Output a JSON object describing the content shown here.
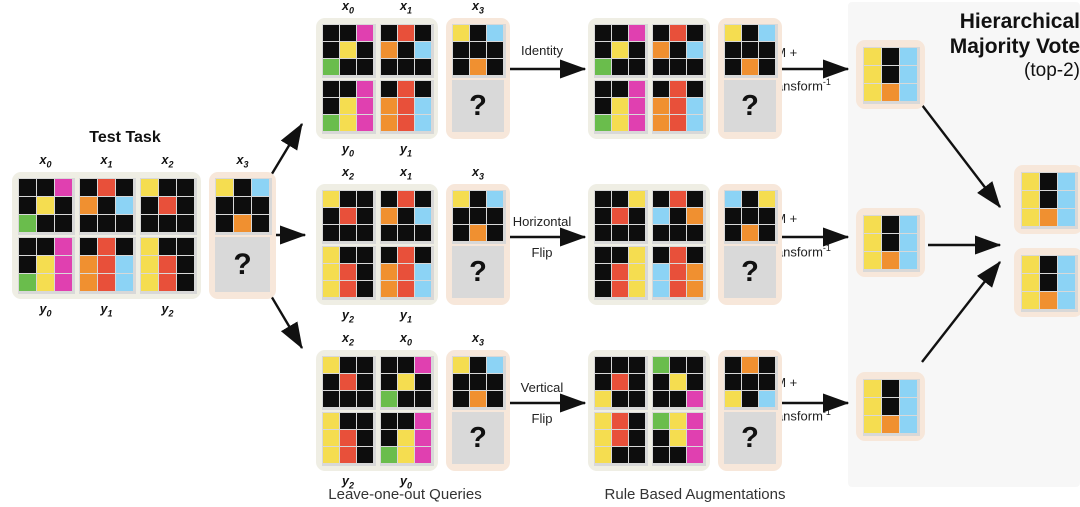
{
  "palette": {
    "black": "#0d0d0d",
    "yellow": "#f5dd50",
    "magenta": "#e040b0",
    "green": "#6abd4c",
    "red": "#e8503a",
    "orange": "#f09030",
    "blue": "#8cd3f5",
    "card_ivory": "#efeee4",
    "card_peach": "#f7e7da",
    "question_bg": "#d9d9d9",
    "panel_bg": "#f7f7f7",
    "grid_line": "#d8d8d8",
    "ink": "#111111"
  },
  "headings": {
    "test_task": "Test Task",
    "hierarchical_majority_vote_l1": "Hierarchical",
    "hierarchical_majority_vote_l2": "Majority Vote",
    "hierarchical_majority_vote_l3": "(top-2)"
  },
  "footer": {
    "leave_one_out": "Leave-one-out Queries",
    "rule_based": "Rule Based Augmentations"
  },
  "transform_labels": {
    "identity": "Identity",
    "horizontal_flip_l1": "Horizontal",
    "horizontal_flip_l2": "Flip",
    "vertical_flip_l1": "Vertical",
    "vertical_flip_l2": "Flip"
  },
  "lm_label": {
    "line1": "LM +",
    "line2": "transform",
    "sup": "-1"
  },
  "question_mark": "?",
  "grid_labels": {
    "x0": "x",
    "x1": "x",
    "x2": "x",
    "x3": "x",
    "y0": "y",
    "y1": "y",
    "y2": "y",
    "sub0": "0",
    "sub1": "1",
    "sub2": "2",
    "sub3": "3"
  },
  "test_task": {
    "pairs": [
      {
        "x_label": "x",
        "x_sub": "0",
        "y_label": "y",
        "y_sub": "0",
        "input": [
          [
            "black",
            "black",
            "magenta"
          ],
          [
            "black",
            "yellow",
            "black"
          ],
          [
            "green",
            "black",
            "black"
          ]
        ],
        "output": [
          [
            "black",
            "black",
            "magenta"
          ],
          [
            "black",
            "yellow",
            "magenta"
          ],
          [
            "green",
            "yellow",
            "magenta"
          ]
        ]
      },
      {
        "x_label": "x",
        "x_sub": "1",
        "y_label": "y",
        "y_sub": "1",
        "input": [
          [
            "black",
            "red",
            "black"
          ],
          [
            "orange",
            "black",
            "blue"
          ],
          [
            "black",
            "black",
            "black"
          ]
        ],
        "output": [
          [
            "black",
            "red",
            "black"
          ],
          [
            "orange",
            "red",
            "blue"
          ],
          [
            "orange",
            "red",
            "blue"
          ]
        ]
      },
      {
        "x_label": "x",
        "x_sub": "2",
        "y_label": "y",
        "y_sub": "2",
        "input": [
          [
            "yellow",
            "black",
            "black"
          ],
          [
            "black",
            "red",
            "black"
          ],
          [
            "black",
            "black",
            "black"
          ]
        ],
        "output": [
          [
            "yellow",
            "black",
            "black"
          ],
          [
            "yellow",
            "red",
            "black"
          ],
          [
            "yellow",
            "red",
            "black"
          ]
        ]
      }
    ],
    "query": {
      "x_label": "x",
      "x_sub": "3",
      "input": [
        [
          "yellow",
          "black",
          "blue"
        ],
        [
          "black",
          "black",
          "black"
        ],
        [
          "black",
          "orange",
          "black"
        ]
      ],
      "answer": "?"
    }
  },
  "queries": [
    {
      "name": "leave-out-query-row-1",
      "pairs": [
        {
          "x_label": "x",
          "x_sub": "0",
          "y_label": "y",
          "y_sub": "0",
          "input": [
            [
              "black",
              "black",
              "magenta"
            ],
            [
              "black",
              "yellow",
              "black"
            ],
            [
              "green",
              "black",
              "black"
            ]
          ],
          "output": [
            [
              "black",
              "black",
              "magenta"
            ],
            [
              "black",
              "yellow",
              "magenta"
            ],
            [
              "green",
              "yellow",
              "magenta"
            ]
          ]
        },
        {
          "x_label": "x",
          "x_sub": "1",
          "y_label": "y",
          "y_sub": "1",
          "input": [
            [
              "black",
              "red",
              "black"
            ],
            [
              "orange",
              "black",
              "blue"
            ],
            [
              "black",
              "black",
              "black"
            ]
          ],
          "output": [
            [
              "black",
              "red",
              "black"
            ],
            [
              "orange",
              "red",
              "blue"
            ],
            [
              "orange",
              "red",
              "blue"
            ]
          ]
        }
      ],
      "query": {
        "x_label": "x",
        "x_sub": "3",
        "input": [
          [
            "yellow",
            "black",
            "blue"
          ],
          [
            "black",
            "black",
            "black"
          ],
          [
            "black",
            "orange",
            "black"
          ]
        ],
        "answer": "?"
      },
      "transform": "identity"
    },
    {
      "name": "leave-out-query-row-2",
      "pairs": [
        {
          "x_label": "x",
          "x_sub": "2",
          "y_label": "y",
          "y_sub": "2",
          "input": [
            [
              "yellow",
              "black",
              "black"
            ],
            [
              "black",
              "red",
              "black"
            ],
            [
              "black",
              "black",
              "black"
            ]
          ],
          "output": [
            [
              "yellow",
              "black",
              "black"
            ],
            [
              "yellow",
              "red",
              "black"
            ],
            [
              "yellow",
              "red",
              "black"
            ]
          ]
        },
        {
          "x_label": "x",
          "x_sub": "1",
          "y_label": "y",
          "y_sub": "1",
          "input": [
            [
              "black",
              "red",
              "black"
            ],
            [
              "orange",
              "black",
              "blue"
            ],
            [
              "black",
              "black",
              "black"
            ]
          ],
          "output": [
            [
              "black",
              "red",
              "black"
            ],
            [
              "orange",
              "red",
              "blue"
            ],
            [
              "orange",
              "red",
              "blue"
            ]
          ]
        }
      ],
      "query": {
        "x_label": "x",
        "x_sub": "3",
        "input": [
          [
            "yellow",
            "black",
            "blue"
          ],
          [
            "black",
            "black",
            "black"
          ],
          [
            "black",
            "orange",
            "black"
          ]
        ],
        "answer": "?"
      },
      "transform": "horizontal_flip"
    },
    {
      "name": "leave-out-query-row-3",
      "pairs": [
        {
          "x_label": "x",
          "x_sub": "2",
          "y_label": "y",
          "y_sub": "2",
          "input": [
            [
              "yellow",
              "black",
              "black"
            ],
            [
              "black",
              "red",
              "black"
            ],
            [
              "black",
              "black",
              "black"
            ]
          ],
          "output": [
            [
              "yellow",
              "black",
              "black"
            ],
            [
              "yellow",
              "red",
              "black"
            ],
            [
              "yellow",
              "red",
              "black"
            ]
          ]
        },
        {
          "x_label": "x",
          "x_sub": "0",
          "y_label": "y",
          "y_sub": "0",
          "input": [
            [
              "black",
              "black",
              "magenta"
            ],
            [
              "black",
              "yellow",
              "black"
            ],
            [
              "green",
              "black",
              "black"
            ]
          ],
          "output": [
            [
              "black",
              "black",
              "magenta"
            ],
            [
              "black",
              "yellow",
              "magenta"
            ],
            [
              "green",
              "yellow",
              "magenta"
            ]
          ]
        }
      ],
      "query": {
        "x_label": "x",
        "x_sub": "3",
        "input": [
          [
            "yellow",
            "black",
            "blue"
          ],
          [
            "black",
            "black",
            "black"
          ],
          [
            "black",
            "orange",
            "black"
          ]
        ],
        "answer": "?"
      },
      "transform": "vertical_flip"
    }
  ],
  "augmentations": [
    {
      "name": "augmented-row-1",
      "pairs": [
        {
          "input": [
            [
              "black",
              "black",
              "magenta"
            ],
            [
              "black",
              "yellow",
              "black"
            ],
            [
              "green",
              "black",
              "black"
            ]
          ],
          "output": [
            [
              "black",
              "black",
              "magenta"
            ],
            [
              "black",
              "yellow",
              "magenta"
            ],
            [
              "green",
              "yellow",
              "magenta"
            ]
          ]
        },
        {
          "input": [
            [
              "black",
              "red",
              "black"
            ],
            [
              "orange",
              "black",
              "blue"
            ],
            [
              "black",
              "black",
              "black"
            ]
          ],
          "output": [
            [
              "black",
              "red",
              "black"
            ],
            [
              "orange",
              "red",
              "blue"
            ],
            [
              "orange",
              "red",
              "blue"
            ]
          ]
        }
      ],
      "query": {
        "input": [
          [
            "yellow",
            "black",
            "blue"
          ],
          [
            "black",
            "black",
            "black"
          ],
          [
            "black",
            "orange",
            "black"
          ]
        ],
        "answer": "?"
      }
    },
    {
      "name": "augmented-row-2",
      "pairs": [
        {
          "input": [
            [
              "black",
              "black",
              "yellow"
            ],
            [
              "black",
              "red",
              "black"
            ],
            [
              "black",
              "black",
              "black"
            ]
          ],
          "output": [
            [
              "black",
              "black",
              "yellow"
            ],
            [
              "black",
              "red",
              "yellow"
            ],
            [
              "black",
              "red",
              "yellow"
            ]
          ]
        },
        {
          "input": [
            [
              "black",
              "red",
              "black"
            ],
            [
              "blue",
              "black",
              "orange"
            ],
            [
              "black",
              "black",
              "black"
            ]
          ],
          "output": [
            [
              "black",
              "red",
              "black"
            ],
            [
              "blue",
              "red",
              "orange"
            ],
            [
              "blue",
              "red",
              "orange"
            ]
          ]
        }
      ],
      "query": {
        "input": [
          [
            "blue",
            "black",
            "yellow"
          ],
          [
            "black",
            "black",
            "black"
          ],
          [
            "black",
            "orange",
            "black"
          ]
        ],
        "answer": "?"
      }
    },
    {
      "name": "augmented-row-3",
      "pairs": [
        {
          "input": [
            [
              "black",
              "black",
              "black"
            ],
            [
              "black",
              "red",
              "black"
            ],
            [
              "yellow",
              "black",
              "black"
            ]
          ],
          "output": [
            [
              "yellow",
              "red",
              "black"
            ],
            [
              "yellow",
              "red",
              "black"
            ],
            [
              "yellow",
              "black",
              "black"
            ]
          ]
        },
        {
          "input": [
            [
              "green",
              "black",
              "black"
            ],
            [
              "black",
              "yellow",
              "black"
            ],
            [
              "black",
              "black",
              "magenta"
            ]
          ],
          "output": [
            [
              "green",
              "yellow",
              "magenta"
            ],
            [
              "black",
              "yellow",
              "magenta"
            ],
            [
              "black",
              "black",
              "magenta"
            ]
          ]
        }
      ],
      "query": {
        "input": [
          [
            "black",
            "orange",
            "black"
          ],
          [
            "black",
            "black",
            "black"
          ],
          [
            "yellow",
            "black",
            "blue"
          ]
        ],
        "answer": "?"
      }
    }
  ],
  "lm_outputs": [
    {
      "name": "lm-output-1",
      "grid": [
        [
          "yellow",
          "black",
          "blue"
        ],
        [
          "yellow",
          "black",
          "blue"
        ],
        [
          "yellow",
          "orange",
          "blue"
        ]
      ]
    },
    {
      "name": "lm-output-2",
      "grid": [
        [
          "yellow",
          "black",
          "blue"
        ],
        [
          "yellow",
          "black",
          "blue"
        ],
        [
          "yellow",
          "orange",
          "blue"
        ]
      ]
    },
    {
      "name": "lm-output-3",
      "grid": [
        [
          "yellow",
          "black",
          "blue"
        ],
        [
          "yellow",
          "black",
          "blue"
        ],
        [
          "yellow",
          "orange",
          "blue"
        ]
      ]
    }
  ],
  "final_outputs": [
    {
      "name": "final-output-rank-1",
      "grid": [
        [
          "yellow",
          "black",
          "blue"
        ],
        [
          "yellow",
          "black",
          "blue"
        ],
        [
          "yellow",
          "orange",
          "blue"
        ]
      ]
    },
    {
      "name": "final-output-rank-2",
      "grid": [
        [
          "yellow",
          "black",
          "blue"
        ],
        [
          "yellow",
          "black",
          "blue"
        ],
        [
          "yellow",
          "orange",
          "blue"
        ]
      ]
    }
  ]
}
